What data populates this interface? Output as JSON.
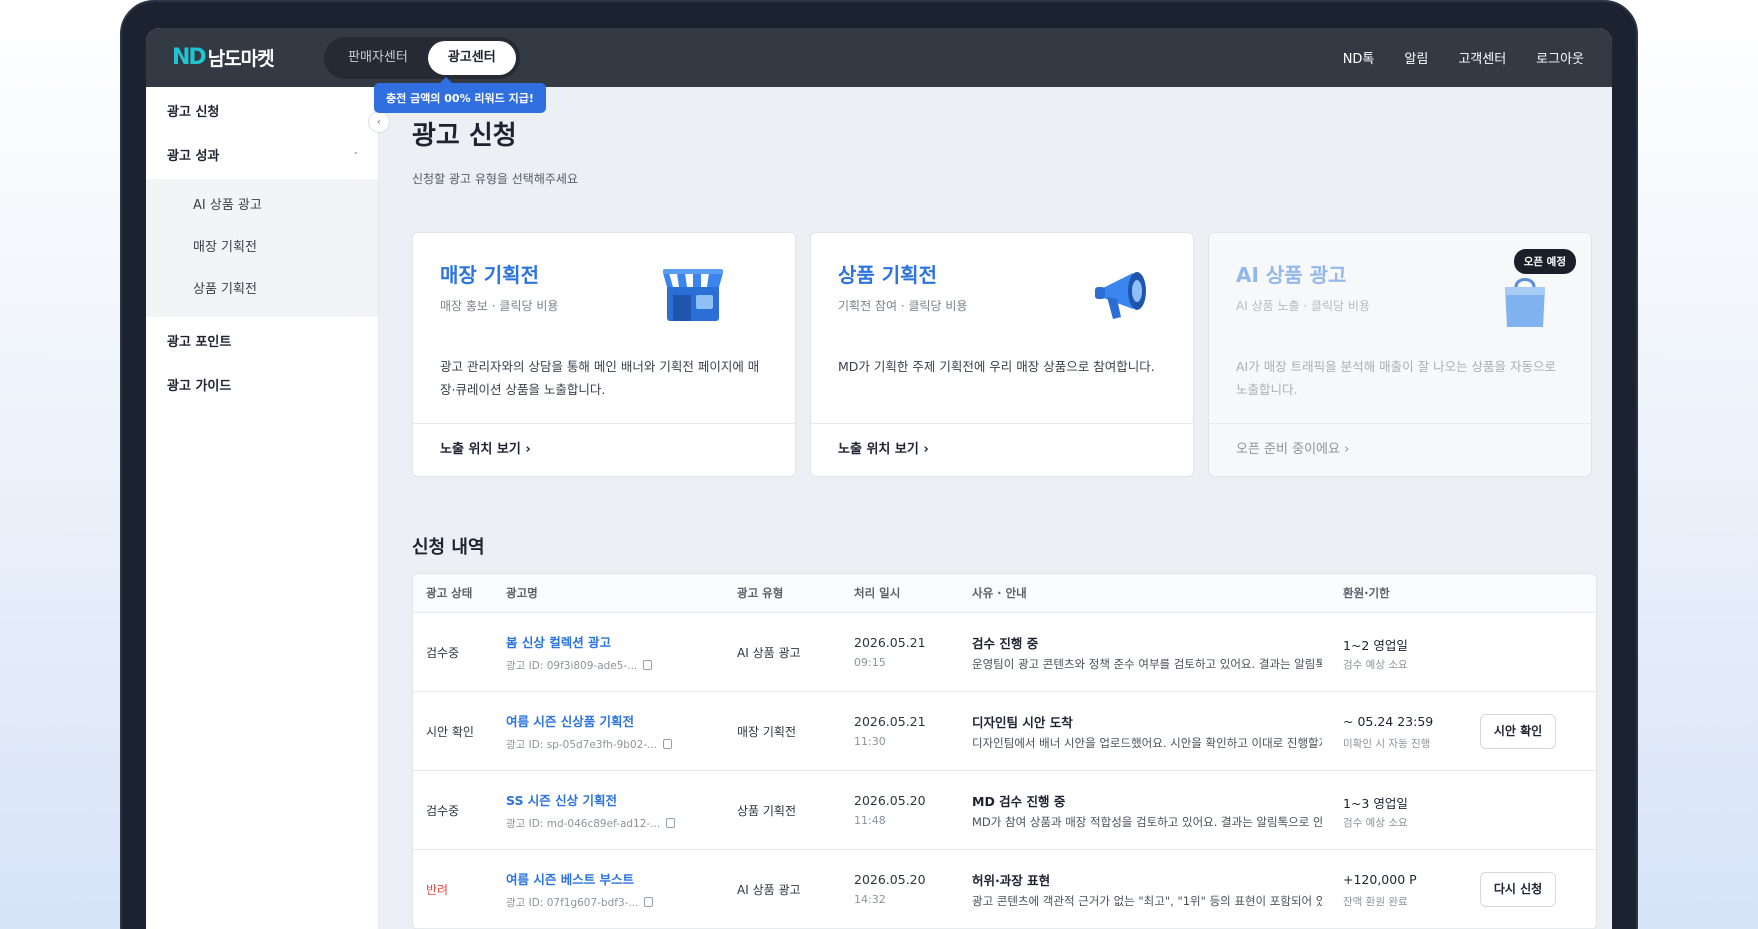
{
  "header": {
    "logo_mark": "ND",
    "logo_text": "남도마켓",
    "tabs": [
      {
        "label": "판매자센터"
      },
      {
        "label": "광고센터"
      }
    ],
    "nav": [
      "ND톡",
      "알림",
      "고객센터",
      "로그아웃"
    ],
    "promo": "충전 금액의 00% 리워드 지급!"
  },
  "sidebar": {
    "items": [
      {
        "label": "광고 신청"
      },
      {
        "label": "광고 성과"
      },
      {
        "label": "광고 포인트"
      },
      {
        "label": "광고 가이드"
      }
    ],
    "sub_items": [
      "AI 상품 광고",
      "매장 기획전",
      "상품 기획전"
    ],
    "collapse_glyph": "‹",
    "caret_glyph": "˄"
  },
  "main": {
    "title": "광고 신청",
    "subtitle": "신청할 광고 유형을 선택해주세요",
    "cards": [
      {
        "title": "매장 기획전",
        "subtitle": "매장 홍보 · 클릭당 비용",
        "description": "광고 관리자와의 상담을 통해 메인 배너와 기획전 페이지에 매장·큐레이션 상품을 노출합니다.",
        "footer": "노출 위치 보기 ›",
        "icon": "storefront-icon"
      },
      {
        "title": "상품 기획전",
        "subtitle": "기획전 참여 · 클릭당 비용",
        "description": "MD가 기획한 주제 기획전에 우리 매장 상품으로 참여합니다.",
        "footer": "노출 위치 보기 ›",
        "icon": "megaphone-icon"
      },
      {
        "title": "AI 상품 광고",
        "subtitle": "AI 상품 노출 · 클릭당 비용",
        "description": "AI가 매장 트래픽을 분석해 매출이 잘 나오는 상품을 자동으로 노출합니다.",
        "footer": "오픈 준비 중이에요 ›",
        "badge": "오픈 예정",
        "icon": "shopping-bag-icon"
      }
    ],
    "history_title": "신청 내역",
    "table": {
      "headers": [
        "광고 상태",
        "광고명",
        "광고 유형",
        "처리 일시",
        "사유 · 안내",
        "환원·기한"
      ],
      "rows": [
        {
          "status": "검수중",
          "name": "봄 신상 컬렉션 광고",
          "id": "광고 ID: 09f3i809-ade5-...",
          "type": "AI 상품 광고",
          "date": "2026.05.21",
          "time": "09:15",
          "reason_title": "검수 진행 중",
          "reason_desc": "운영팀이 광고 콘텐츠와 정책 준수 여부를 검토하고 있어요. 결과는 알림톡으로 안내드려요.",
          "refund": "1~2 영업일",
          "refund_sub": "검수 예상 소요",
          "action": ""
        },
        {
          "status": "시안 확인",
          "name": "여름 시즌 신상품 기획전",
          "id": "광고 ID: sp-05d7e3fh-9b02-...",
          "type": "매장 기획전",
          "date": "2026.05.21",
          "time": "11:30",
          "reason_title": "디자인팀 시안 도착",
          "reason_desc": "디자인팀에서 배너 시안을 업로드했어요. 시안을 확인하고 이대로 진행할지 알려주세요.",
          "refund": "~ 05.24 23:59",
          "refund_sub": "미확인 시 자동 진행",
          "action": "시안 확인"
        },
        {
          "status": "검수중",
          "name": "SS 시즌 신상 기획전",
          "id": "광고 ID: md-046c89ef-ad12-...",
          "type": "상품 기획전",
          "date": "2026.05.20",
          "time": "11:48",
          "reason_title": "MD 검수 진행 중",
          "reason_desc": "MD가 참여 상품과 매장 적합성을 검토하고 있어요. 결과는 알림톡으로 안내드려요.",
          "refund": "1~3 영업일",
          "refund_sub": "검수 예상 소요",
          "action": ""
        },
        {
          "status": "반려",
          "status_color": "#e5483e",
          "name": "여름 시즌 베스트 부스트",
          "id": "광고 ID: 07f1g607-bdf3-...",
          "type": "AI 상품 광고",
          "date": "2026.05.20",
          "time": "14:32",
          "reason_title": "허위·과장 표현",
          "reason_desc": "광고 콘텐츠에 객관적 근거가 없는 \"최고\", \"1위\" 등의 표현이 포함되어 있어요.",
          "refund": "+120,000 P",
          "refund_sub": "잔액 환원 완료",
          "action": "다시 신청"
        }
      ]
    }
  },
  "colors": {
    "accent": "#2b73e0",
    "topbar": "#343a44",
    "rejected": "#e5483e",
    "logo": "#22c4d3"
  }
}
